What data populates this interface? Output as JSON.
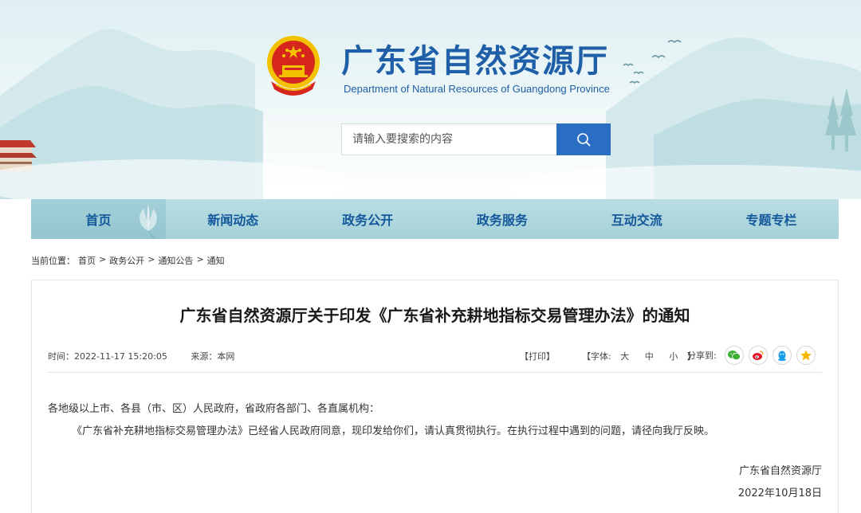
{
  "header": {
    "site_title": "广东省自然资源厅",
    "site_subtitle": "Department of Natural Resources of Guangdong Province"
  },
  "search": {
    "placeholder": "请输入要搜索的内容",
    "button_icon": "search-icon",
    "button_color": "#2a6ec4"
  },
  "nav": {
    "items": [
      {
        "label": "首页",
        "active": true
      },
      {
        "label": "新闻动态"
      },
      {
        "label": "政务公开"
      },
      {
        "label": "政务服务"
      },
      {
        "label": "互动交流"
      },
      {
        "label": "专题专栏"
      }
    ]
  },
  "breadcrumb": {
    "prefix": "当前位置：",
    "items": [
      "首页",
      "政务公开",
      "通知公告",
      "通知"
    ],
    "separator": ">"
  },
  "article": {
    "title": "广东省自然资源厅关于印发《广东省补充耕地指标交易管理办法》的通知",
    "time": "时间：2022-11-17 15:20:05",
    "source": "来源：本网",
    "print_label": "【打印】",
    "font_label": "【字体:",
    "font_large": "大",
    "font_medium": "中",
    "font_small": "小",
    "font_close": "】",
    "share_label": "分享到:",
    "share_icons": [
      "wechat-icon",
      "weibo-icon",
      "qq-icon",
      "qzone-icon"
    ],
    "salutation": "各地级以上市、各县（市、区）人民政府，省政府各部门、各直属机构：",
    "paragraph": "《广东省补充耕地指标交易管理办法》已经省人民政府同意，现印发给你们，请认真贯彻执行。在执行过程中遇到的问题，请径向我厅反映。",
    "signature_org": "广东省自然资源厅",
    "signature_date": "2022年10月18日"
  },
  "colors": {
    "brand_blue": "#1e5fa8",
    "nav_bg": "#a6d1d9",
    "emblem_red": "#d7261e",
    "emblem_gold": "#f2c200"
  }
}
